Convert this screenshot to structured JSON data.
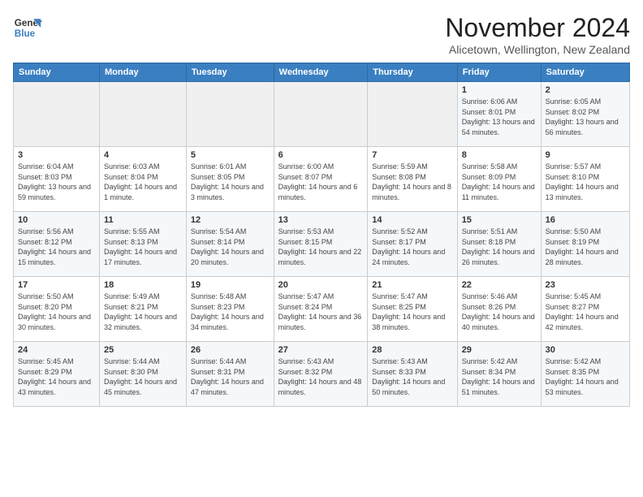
{
  "logo": {
    "line1": "General",
    "line2": "Blue"
  },
  "title": "November 2024",
  "subtitle": "Alicetown, Wellington, New Zealand",
  "headers": [
    "Sunday",
    "Monday",
    "Tuesday",
    "Wednesday",
    "Thursday",
    "Friday",
    "Saturday"
  ],
  "weeks": [
    [
      {
        "day": "",
        "sunrise": "",
        "sunset": "",
        "daylight": ""
      },
      {
        "day": "",
        "sunrise": "",
        "sunset": "",
        "daylight": ""
      },
      {
        "day": "",
        "sunrise": "",
        "sunset": "",
        "daylight": ""
      },
      {
        "day": "",
        "sunrise": "",
        "sunset": "",
        "daylight": ""
      },
      {
        "day": "",
        "sunrise": "",
        "sunset": "",
        "daylight": ""
      },
      {
        "day": "1",
        "sunrise": "Sunrise: 6:06 AM",
        "sunset": "Sunset: 8:01 PM",
        "daylight": "Daylight: 13 hours and 54 minutes."
      },
      {
        "day": "2",
        "sunrise": "Sunrise: 6:05 AM",
        "sunset": "Sunset: 8:02 PM",
        "daylight": "Daylight: 13 hours and 56 minutes."
      }
    ],
    [
      {
        "day": "3",
        "sunrise": "Sunrise: 6:04 AM",
        "sunset": "Sunset: 8:03 PM",
        "daylight": "Daylight: 13 hours and 59 minutes."
      },
      {
        "day": "4",
        "sunrise": "Sunrise: 6:03 AM",
        "sunset": "Sunset: 8:04 PM",
        "daylight": "Daylight: 14 hours and 1 minute."
      },
      {
        "day": "5",
        "sunrise": "Sunrise: 6:01 AM",
        "sunset": "Sunset: 8:05 PM",
        "daylight": "Daylight: 14 hours and 3 minutes."
      },
      {
        "day": "6",
        "sunrise": "Sunrise: 6:00 AM",
        "sunset": "Sunset: 8:07 PM",
        "daylight": "Daylight: 14 hours and 6 minutes."
      },
      {
        "day": "7",
        "sunrise": "Sunrise: 5:59 AM",
        "sunset": "Sunset: 8:08 PM",
        "daylight": "Daylight: 14 hours and 8 minutes."
      },
      {
        "day": "8",
        "sunrise": "Sunrise: 5:58 AM",
        "sunset": "Sunset: 8:09 PM",
        "daylight": "Daylight: 14 hours and 11 minutes."
      },
      {
        "day": "9",
        "sunrise": "Sunrise: 5:57 AM",
        "sunset": "Sunset: 8:10 PM",
        "daylight": "Daylight: 14 hours and 13 minutes."
      }
    ],
    [
      {
        "day": "10",
        "sunrise": "Sunrise: 5:56 AM",
        "sunset": "Sunset: 8:12 PM",
        "daylight": "Daylight: 14 hours and 15 minutes."
      },
      {
        "day": "11",
        "sunrise": "Sunrise: 5:55 AM",
        "sunset": "Sunset: 8:13 PM",
        "daylight": "Daylight: 14 hours and 17 minutes."
      },
      {
        "day": "12",
        "sunrise": "Sunrise: 5:54 AM",
        "sunset": "Sunset: 8:14 PM",
        "daylight": "Daylight: 14 hours and 20 minutes."
      },
      {
        "day": "13",
        "sunrise": "Sunrise: 5:53 AM",
        "sunset": "Sunset: 8:15 PM",
        "daylight": "Daylight: 14 hours and 22 minutes."
      },
      {
        "day": "14",
        "sunrise": "Sunrise: 5:52 AM",
        "sunset": "Sunset: 8:17 PM",
        "daylight": "Daylight: 14 hours and 24 minutes."
      },
      {
        "day": "15",
        "sunrise": "Sunrise: 5:51 AM",
        "sunset": "Sunset: 8:18 PM",
        "daylight": "Daylight: 14 hours and 26 minutes."
      },
      {
        "day": "16",
        "sunrise": "Sunrise: 5:50 AM",
        "sunset": "Sunset: 8:19 PM",
        "daylight": "Daylight: 14 hours and 28 minutes."
      }
    ],
    [
      {
        "day": "17",
        "sunrise": "Sunrise: 5:50 AM",
        "sunset": "Sunset: 8:20 PM",
        "daylight": "Daylight: 14 hours and 30 minutes."
      },
      {
        "day": "18",
        "sunrise": "Sunrise: 5:49 AM",
        "sunset": "Sunset: 8:21 PM",
        "daylight": "Daylight: 14 hours and 32 minutes."
      },
      {
        "day": "19",
        "sunrise": "Sunrise: 5:48 AM",
        "sunset": "Sunset: 8:23 PM",
        "daylight": "Daylight: 14 hours and 34 minutes."
      },
      {
        "day": "20",
        "sunrise": "Sunrise: 5:47 AM",
        "sunset": "Sunset: 8:24 PM",
        "daylight": "Daylight: 14 hours and 36 minutes."
      },
      {
        "day": "21",
        "sunrise": "Sunrise: 5:47 AM",
        "sunset": "Sunset: 8:25 PM",
        "daylight": "Daylight: 14 hours and 38 minutes."
      },
      {
        "day": "22",
        "sunrise": "Sunrise: 5:46 AM",
        "sunset": "Sunset: 8:26 PM",
        "daylight": "Daylight: 14 hours and 40 minutes."
      },
      {
        "day": "23",
        "sunrise": "Sunrise: 5:45 AM",
        "sunset": "Sunset: 8:27 PM",
        "daylight": "Daylight: 14 hours and 42 minutes."
      }
    ],
    [
      {
        "day": "24",
        "sunrise": "Sunrise: 5:45 AM",
        "sunset": "Sunset: 8:29 PM",
        "daylight": "Daylight: 14 hours and 43 minutes."
      },
      {
        "day": "25",
        "sunrise": "Sunrise: 5:44 AM",
        "sunset": "Sunset: 8:30 PM",
        "daylight": "Daylight: 14 hours and 45 minutes."
      },
      {
        "day": "26",
        "sunrise": "Sunrise: 5:44 AM",
        "sunset": "Sunset: 8:31 PM",
        "daylight": "Daylight: 14 hours and 47 minutes."
      },
      {
        "day": "27",
        "sunrise": "Sunrise: 5:43 AM",
        "sunset": "Sunset: 8:32 PM",
        "daylight": "Daylight: 14 hours and 48 minutes."
      },
      {
        "day": "28",
        "sunrise": "Sunrise: 5:43 AM",
        "sunset": "Sunset: 8:33 PM",
        "daylight": "Daylight: 14 hours and 50 minutes."
      },
      {
        "day": "29",
        "sunrise": "Sunrise: 5:42 AM",
        "sunset": "Sunset: 8:34 PM",
        "daylight": "Daylight: 14 hours and 51 minutes."
      },
      {
        "day": "30",
        "sunrise": "Sunrise: 5:42 AM",
        "sunset": "Sunset: 8:35 PM",
        "daylight": "Daylight: 14 hours and 53 minutes."
      }
    ]
  ]
}
